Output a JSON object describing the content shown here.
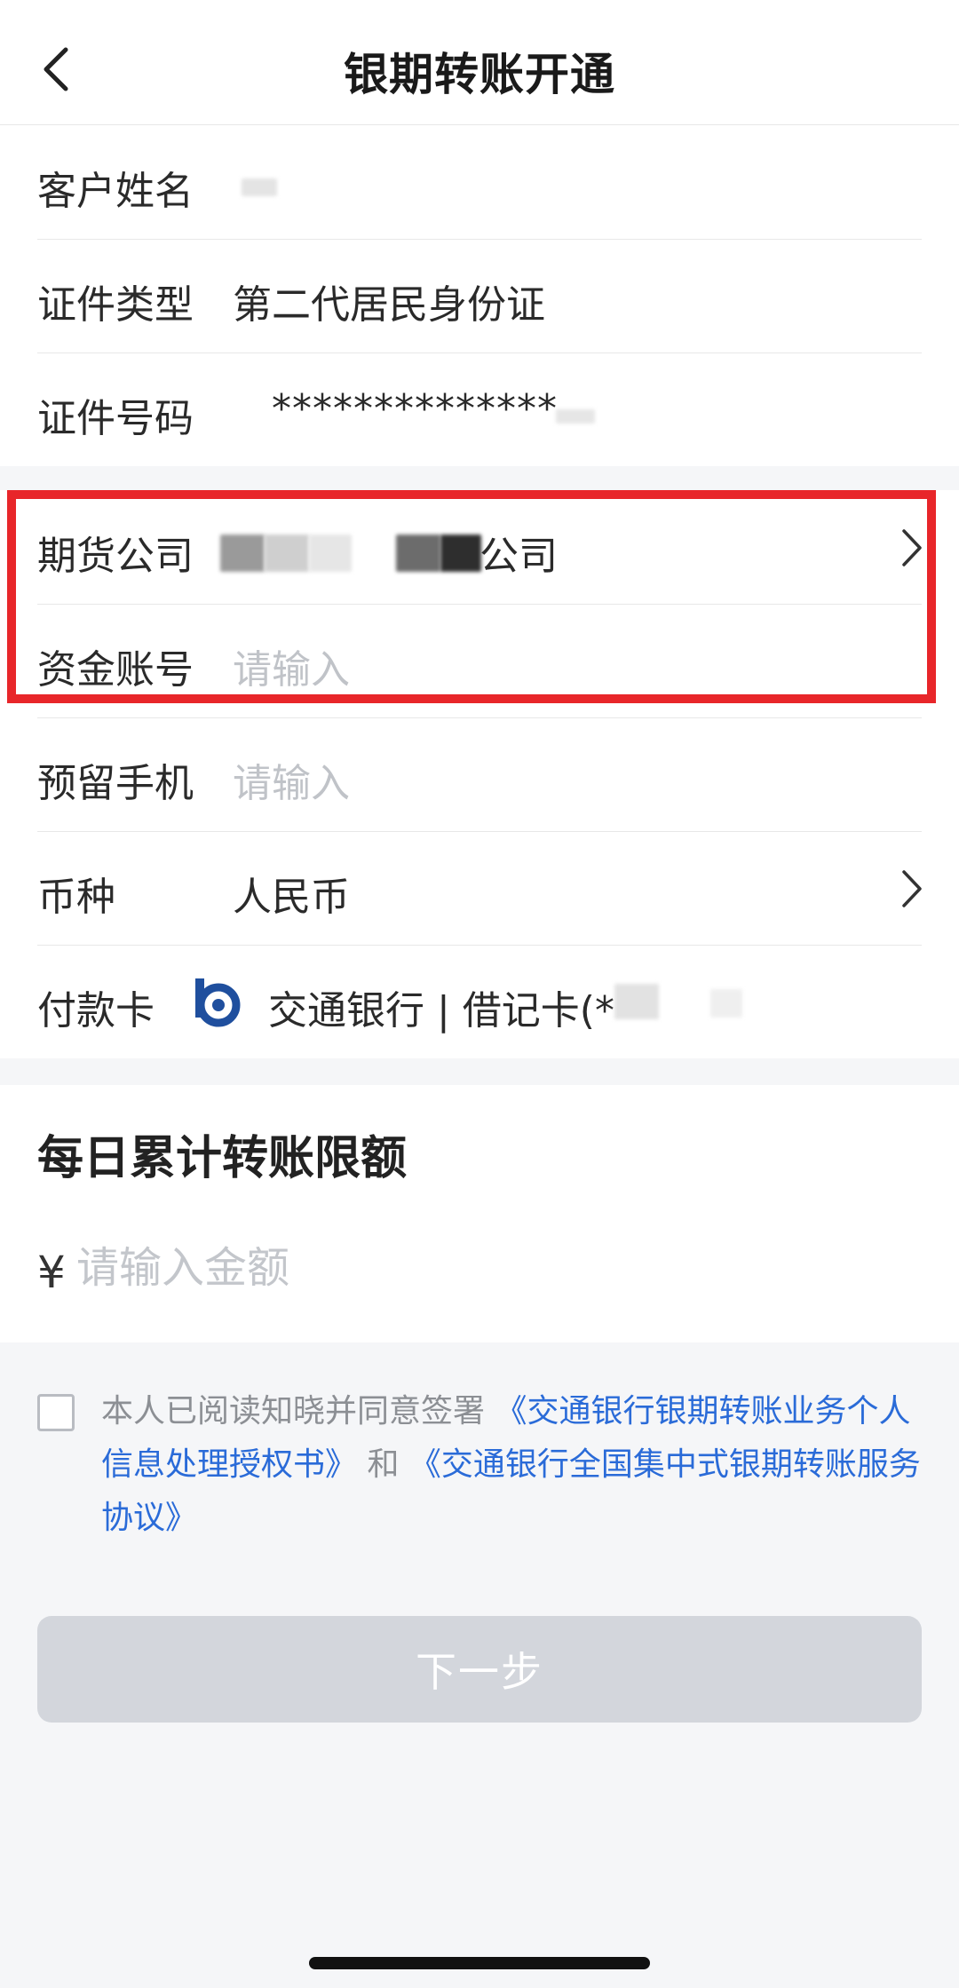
{
  "header": {
    "title": "银期转账开通",
    "back_icon": "chevron-left-icon"
  },
  "info": {
    "name_label": "客户姓名",
    "id_type_label": "证件类型",
    "id_type_value": "第二代居民身份证",
    "id_number_label": "证件号码",
    "id_number_value": "**************"
  },
  "account": {
    "company_label": "期货公司",
    "company_value_suffix": "公司",
    "fund_account_label": "资金账号",
    "fund_account_placeholder": "请输入",
    "phone_label": "预留手机",
    "phone_placeholder": "请输入",
    "currency_label": "币种",
    "currency_value": "人民币",
    "card_label": "付款卡",
    "card_value": "交通银行 | 借记卡(*",
    "bank_icon": "bank-of-communications-logo-icon"
  },
  "limit": {
    "title": "每日累计转账限额",
    "currency_symbol": "¥",
    "amount_placeholder": "请输入金额"
  },
  "agreement": {
    "prefix": "本人已阅读知晓并同意签署 ",
    "doc1": "《交通银行银期转账业务个人信息处理授权书》",
    "connector": " 和 ",
    "doc2": "《交通银行全国集中式银期转账服务协议》",
    "checked": false
  },
  "actions": {
    "next_label": "下一步"
  },
  "colors": {
    "highlight": "#e8262a",
    "link": "#2a6bd8",
    "bank_logo": "#1f4f9e",
    "button_disabled": "#d3d6dc"
  }
}
